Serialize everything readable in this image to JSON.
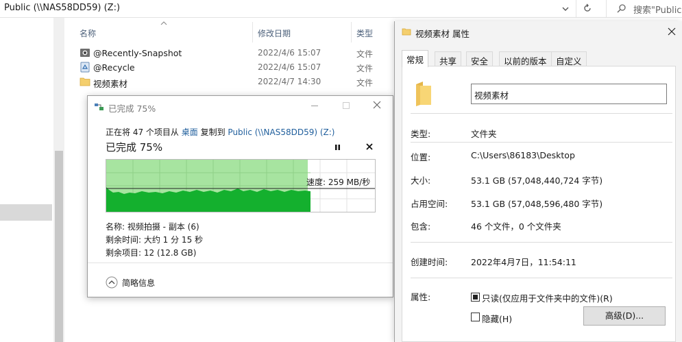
{
  "explorer": {
    "path": "Public (\\\\NAS58DD59) (Z:)",
    "search_placeholder": "搜索\"Public (",
    "columns": {
      "name": "名称",
      "modified": "修改日期",
      "type": "类型"
    },
    "files": [
      {
        "name": "@Recently-Snapshot",
        "date": "2022/4/6 15:07",
        "type": "文件",
        "icon": "camera-folder-icon"
      },
      {
        "name": "@Recycle",
        "date": "2022/4/6 15:07",
        "type": "文件",
        "icon": "recycle-bin-icon"
      },
      {
        "name": "视频素材",
        "date": "2022/4/7 14:30",
        "type": "文件",
        "icon": "folder-icon"
      }
    ]
  },
  "copy_dialog": {
    "title": "已完成 75%",
    "progress_pct": 75,
    "summary_prefix": "正在将 47 个项目从",
    "source": "桌面",
    "summary_mid": "复制到",
    "destination": "Public (\\\\NAS58DD59) (Z:)",
    "progress_title": "已完成 75%",
    "speed": "速度: 259 MB/秒",
    "name_line": "名称: 视频拍摄 - 副本 (6)",
    "time_left": "剩余时间: 大约 1 分 15 秒",
    "items_left": "剩余项目: 12 (12.8 GB)",
    "less_info": "简略信息"
  },
  "props_dialog": {
    "title": "视频素材 属性",
    "tabs": [
      "常规",
      "共享",
      "安全",
      "以前的版本",
      "自定义"
    ],
    "folder_name": "视频素材",
    "labels": {
      "type": "类型:",
      "location": "位置:",
      "size": "大小:",
      "size_on_disk": "占用空间:",
      "contains": "包含:",
      "created": "创建时间:",
      "attributes": "属性:"
    },
    "values": {
      "type": "文件夹",
      "location": "C:\\Users\\86183\\Desktop",
      "size": "53.1 GB (57,048,440,724 字节)",
      "size_on_disk": "53.1 GB (57,048,596,480 字节)",
      "contains": "46 个文件，0 个文件夹",
      "created": "2022年4月7日，11:54:11"
    },
    "readonly_label": "只读(仅应用于文件夹中的文件)(R)",
    "hidden_label": "隐藏(H)",
    "advanced_button": "高级(D)..."
  },
  "colors": {
    "progress_fill": "#a7e4a0",
    "speed_graph": "#14b02e",
    "link": "#1f5e9c"
  }
}
